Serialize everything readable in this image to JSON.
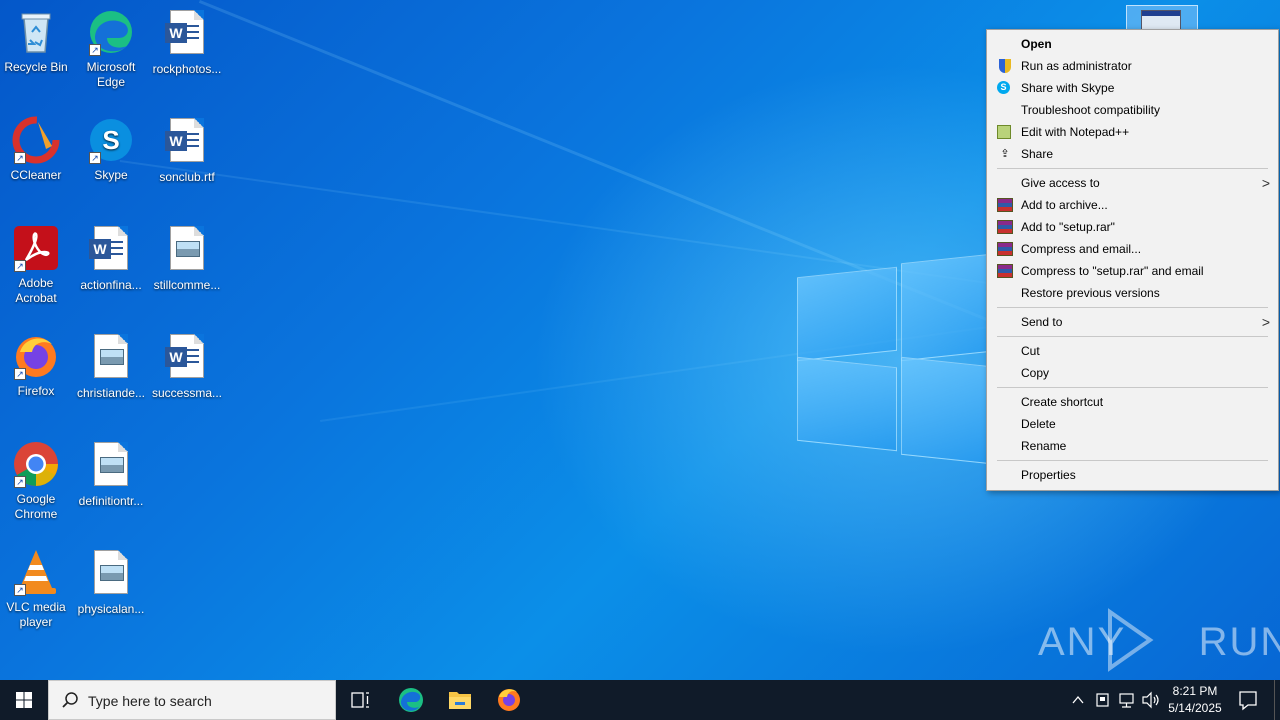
{
  "desktop": {
    "icons": [
      {
        "label": "Recycle Bin"
      },
      {
        "label": "Microsoft Edge"
      },
      {
        "label": "rockphotos..."
      },
      {
        "label": "CCleaner"
      },
      {
        "label": "Skype"
      },
      {
        "label": "sonclub.rtf"
      },
      {
        "label": "Adobe Acrobat"
      },
      {
        "label": "actionfina..."
      },
      {
        "label": "stillcomme..."
      },
      {
        "label": "Firefox"
      },
      {
        "label": "christiande..."
      },
      {
        "label": "successma..."
      },
      {
        "label": "Google Chrome"
      },
      {
        "label": "definitiontr..."
      },
      {
        "label": "VLC media player"
      },
      {
        "label": "physicalan..."
      }
    ],
    "watermark": "ANY RUN"
  },
  "context_menu": {
    "items": [
      {
        "label": "Open",
        "icon": ""
      },
      {
        "label": "Run as administrator",
        "icon": "shield-icon"
      },
      {
        "label": "Share with Skype",
        "icon": "skype-icon"
      },
      {
        "label": "Troubleshoot compatibility",
        "icon": ""
      },
      {
        "label": "Edit with Notepad++",
        "icon": "notepadpp-icon"
      },
      {
        "label": "Share",
        "icon": "share-icon"
      },
      {
        "label": "Give access to",
        "icon": ""
      },
      {
        "label": "Add to archive...",
        "icon": "winrar-icon"
      },
      {
        "label": "Add to \"setup.rar\"",
        "icon": "winrar-icon"
      },
      {
        "label": "Compress and email...",
        "icon": "winrar-icon"
      },
      {
        "label": "Compress to \"setup.rar\" and email",
        "icon": "winrar-icon"
      },
      {
        "label": "Restore previous versions",
        "icon": ""
      },
      {
        "label": "Send to",
        "icon": ""
      },
      {
        "label": "Cut",
        "icon": ""
      },
      {
        "label": "Copy",
        "icon": ""
      },
      {
        "label": "Create shortcut",
        "icon": ""
      },
      {
        "label": "Delete",
        "icon": ""
      },
      {
        "label": "Rename",
        "icon": ""
      },
      {
        "label": "Properties",
        "icon": ""
      }
    ]
  },
  "taskbar": {
    "search_placeholder": "Type here to search",
    "time": "8:21 PM",
    "date": "5/14/2025"
  }
}
